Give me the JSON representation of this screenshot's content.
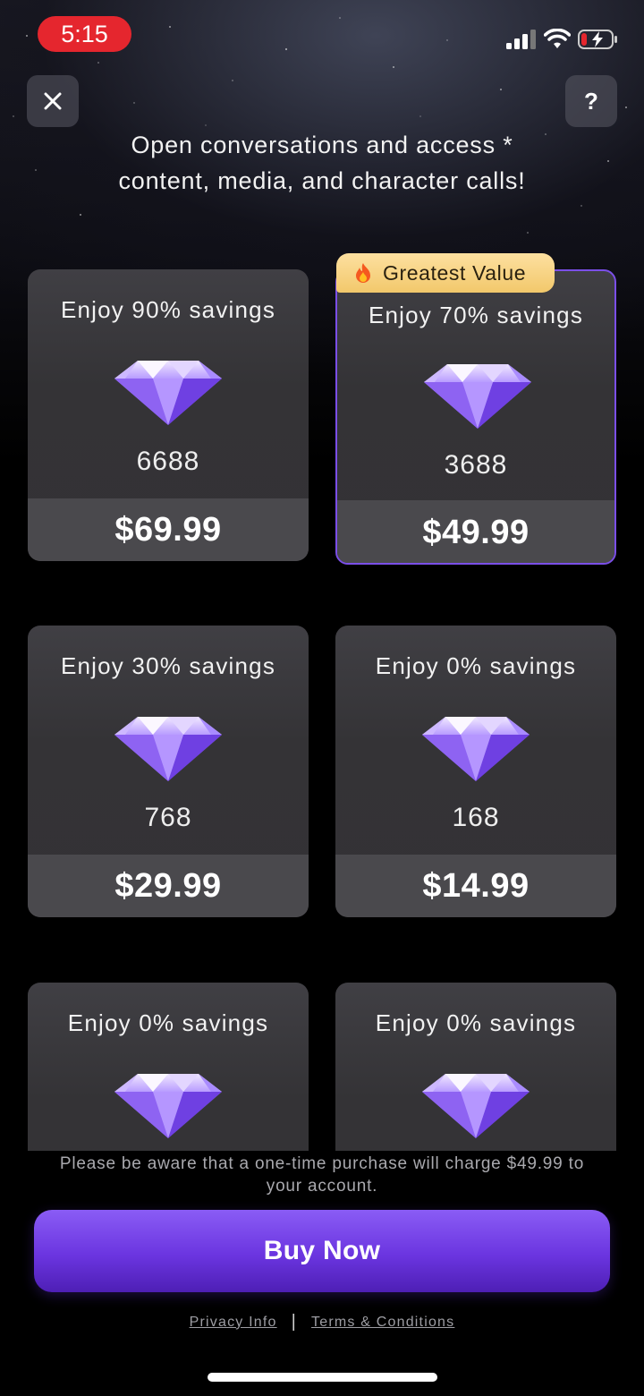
{
  "status_bar": {
    "time": "5:15"
  },
  "header": {
    "close_icon": "close-icon",
    "help_label": "?",
    "headline": "Open conversations and access * content, media, and character calls!"
  },
  "packages": [
    {
      "savings": "Enjoy 90% savings",
      "amount": "6688",
      "price": "$69.99",
      "selected": false
    },
    {
      "savings": "Enjoy 70% savings",
      "amount": "3688",
      "price": "$49.99",
      "selected": true,
      "badge": "Greatest Value"
    },
    {
      "savings": "Enjoy 30% savings",
      "amount": "768",
      "price": "$29.99",
      "selected": false
    },
    {
      "savings": "Enjoy 0% savings",
      "amount": "168",
      "price": "$14.99",
      "selected": false
    },
    {
      "savings": "Enjoy 0% savings",
      "amount": "",
      "price": "",
      "selected": false
    },
    {
      "savings": "Enjoy 0% savings",
      "amount": "",
      "price": "",
      "selected": false
    }
  ],
  "badge": {
    "icon": "fire-icon",
    "label": "Greatest Value"
  },
  "notice": "Please be aware that a one-time purchase will charge $49.99 to your account.",
  "buy_button": {
    "label": "Buy Now"
  },
  "footer": {
    "privacy": "Privacy Info",
    "separator": "|",
    "terms": "Terms & Conditions"
  },
  "colors": {
    "accent": "#7b4fe8",
    "badge": "#f5d07e",
    "status_time": "#e5262e"
  }
}
